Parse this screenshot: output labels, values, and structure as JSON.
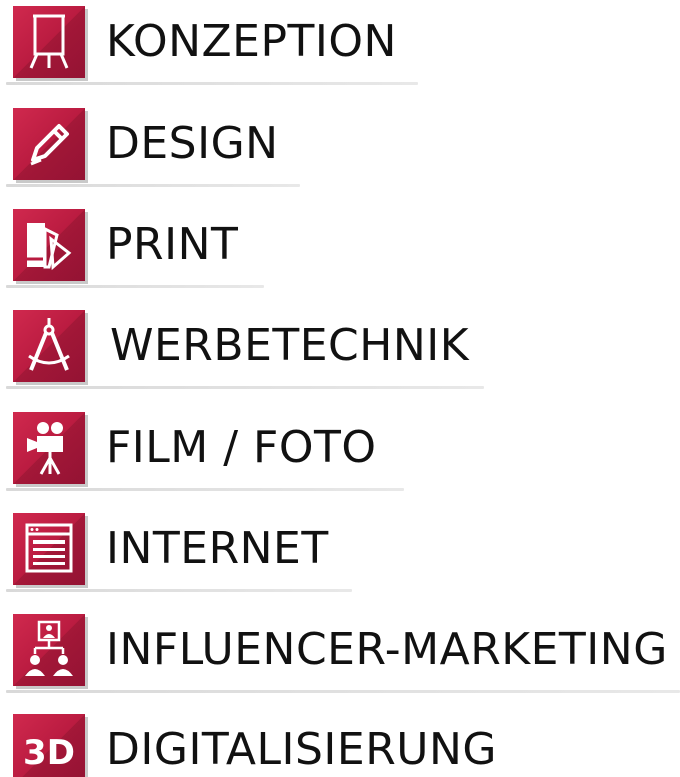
{
  "colors": {
    "accent": "#b81a3f",
    "text": "#111111",
    "underline": "#dcdcdc"
  },
  "menu": {
    "items": [
      {
        "label": "KONZEPTION",
        "icon": "flipchart-icon"
      },
      {
        "label": "DESIGN",
        "icon": "pencil-icon"
      },
      {
        "label": "PRINT",
        "icon": "color-fan-icon"
      },
      {
        "label": "WERBETECHNIK",
        "icon": "compass-icon"
      },
      {
        "label": "FILM / FOTO",
        "icon": "film-camera-icon"
      },
      {
        "label": "INTERNET",
        "icon": "browser-window-icon"
      },
      {
        "label": "INFLUENCER-MARKETING",
        "icon": "people-network-icon"
      },
      {
        "label": "DIGITALISIERUNG",
        "icon": "3d-icon",
        "icon_text": "3D"
      }
    ]
  }
}
